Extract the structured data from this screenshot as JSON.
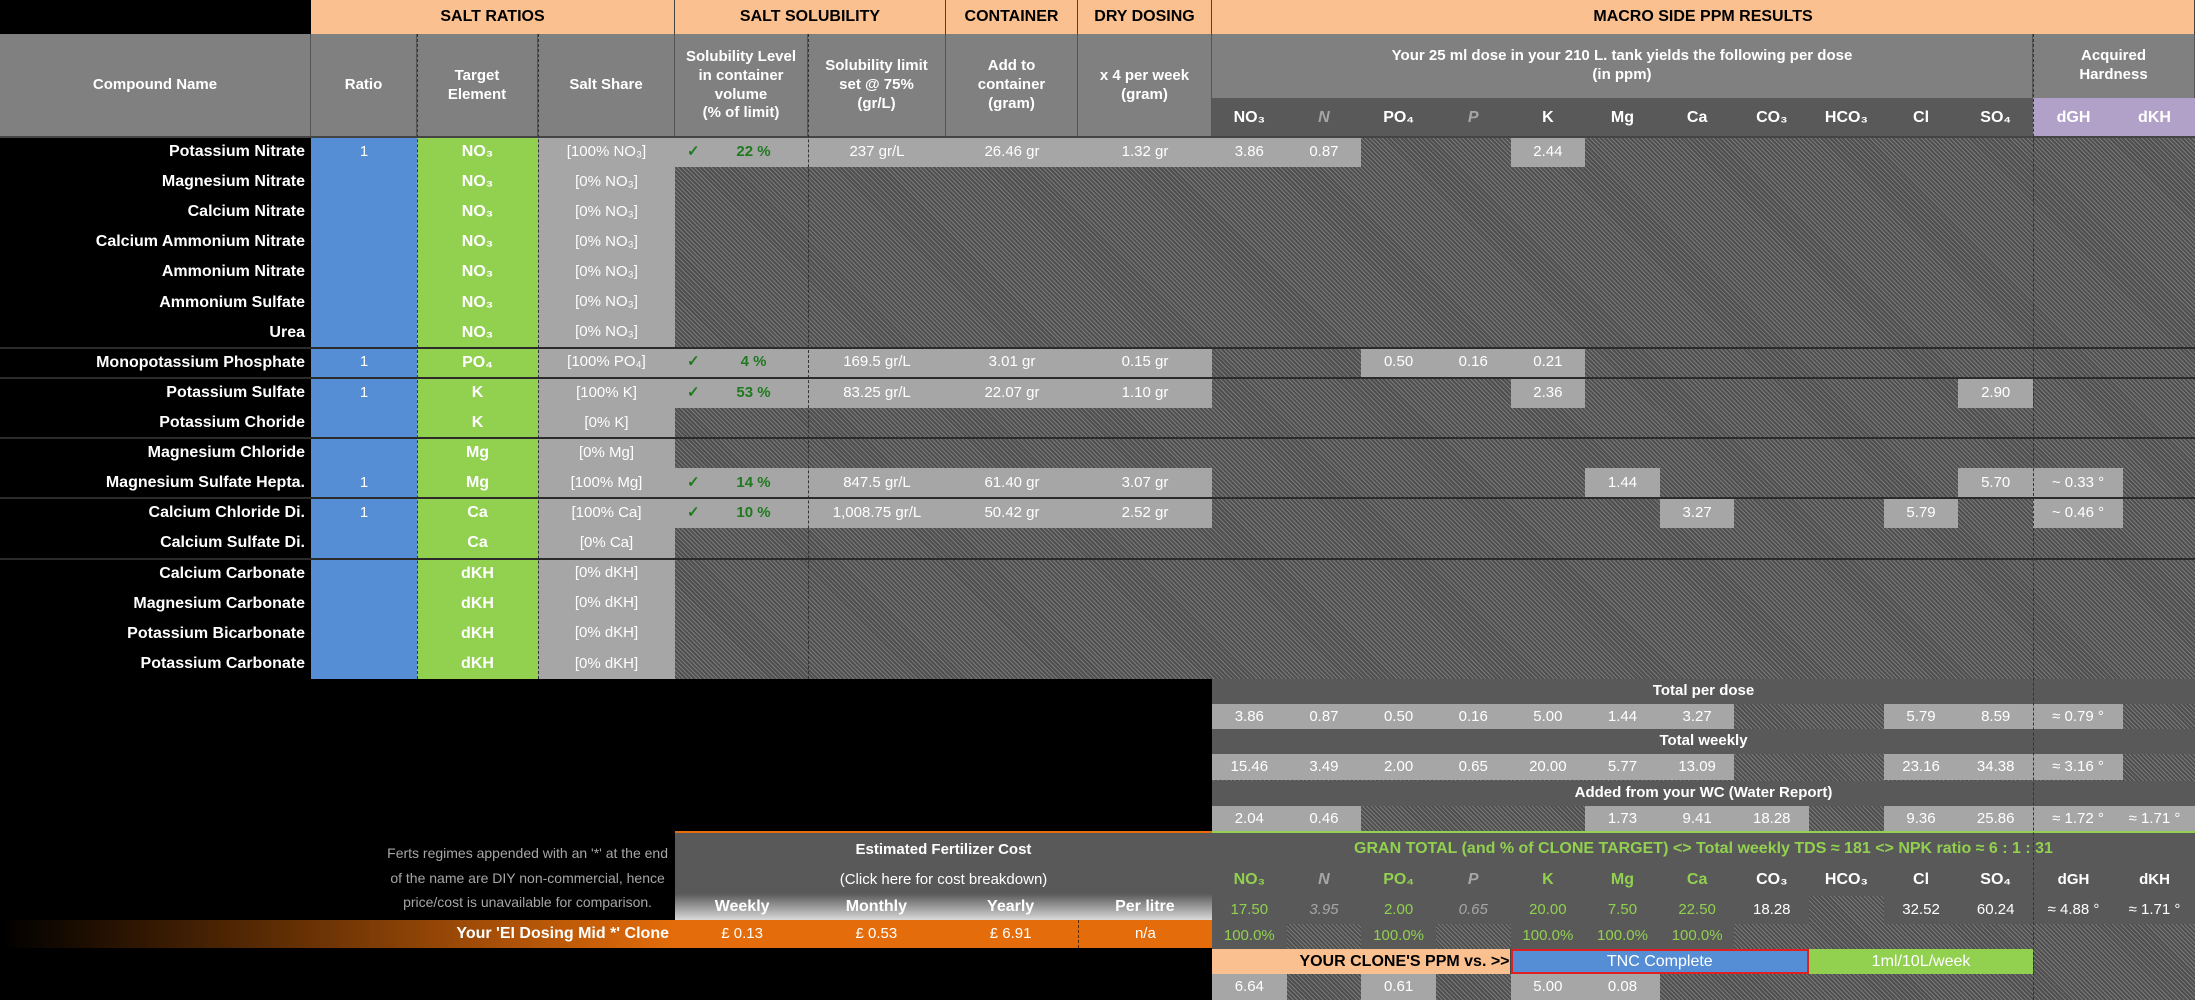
{
  "header": {
    "salt_ratios": "SALT  RATIOS",
    "salt_solubility": "SALT SOLUBILITY",
    "container": "CONTAINER",
    "dry_dosing": "DRY  DOSING",
    "macro": "MACRO SIDE PPM RESULTS"
  },
  "columns": {
    "compound": "Compound Name",
    "ratio": "Ratio",
    "target": "Target\nElement",
    "share": "Salt Share",
    "sol_level": "Solubility Level\nin container\nvolume\n(% of limit)",
    "sol_limit": "Solubility limit\nset @ 75%\n(gr/L)",
    "add": "Add to\ncontainer\n(gram)",
    "dry": "x 4 per week\n(gram)"
  },
  "macro_caption": "Your 25 ml dose in your 210 L. tank yields the following per dose\n(in ppm)",
  "hardness_caption": "Acquired\nHardness",
  "elements": [
    "NO₃",
    "N",
    "PO₄",
    "P",
    "K",
    "Mg",
    "Ca",
    "CO₃",
    "HCO₃",
    "Cl",
    "SO₄"
  ],
  "hardness_cols": [
    "dGH",
    "dKH"
  ],
  "rows": [
    {
      "name": "Potassium Nitrate",
      "ratio": "1",
      "target": "NO₃",
      "share": "[100% NO₃]",
      "sol_level": "22 %",
      "sol_limit": "237 gr/L",
      "add": "26.46 gr",
      "dry": "1.32 gr",
      "ppm": [
        "3.86",
        "0.87",
        null,
        null,
        "2.44",
        null,
        null,
        null,
        null,
        null,
        null
      ],
      "dgh": null
    },
    {
      "name": "Magnesium Nitrate",
      "ratio": "",
      "target": "NO₃",
      "share": "[0% NO₃]"
    },
    {
      "name": "Calcium Nitrate",
      "ratio": "",
      "target": "NO₃",
      "share": "[0% NO₃]"
    },
    {
      "name": "Calcium Ammonium Nitrate",
      "ratio": "",
      "target": "NO₃",
      "share": "[0% NO₃]"
    },
    {
      "name": "Ammonium Nitrate",
      "ratio": "",
      "target": "NO₃",
      "share": "[0% NO₃]"
    },
    {
      "name": "Ammonium Sulfate",
      "ratio": "",
      "target": "NO₃",
      "share": "[0% NO₃]"
    },
    {
      "name": "Urea",
      "ratio": "",
      "target": "NO₃",
      "share": "[0% NO₃]"
    },
    {
      "name": "Monopotassium Phosphate",
      "ratio": "1",
      "target": "PO₄",
      "share": "[100% PO₄]",
      "sol_level": "4 %",
      "sol_limit": "169.5 gr/L",
      "add": "3.01 gr",
      "dry": "0.15 gr",
      "ppm": [
        null,
        null,
        "0.50",
        "0.16",
        "0.21",
        null,
        null,
        null,
        null,
        null,
        null
      ],
      "dgh": null
    },
    {
      "name": "Potassium Sulfate",
      "ratio": "1",
      "target": "K",
      "share": "[100% K]",
      "sol_level": "53 %",
      "sol_limit": "83.25 gr/L",
      "add": "22.07 gr",
      "dry": "1.10 gr",
      "ppm": [
        null,
        null,
        null,
        null,
        "2.36",
        null,
        null,
        null,
        null,
        null,
        "2.90"
      ],
      "dgh": null
    },
    {
      "name": "Potassium Choride",
      "ratio": "",
      "target": "K",
      "share": "[0% K]"
    },
    {
      "name": "Magnesium Chloride",
      "ratio": "",
      "target": "Mg",
      "share": "[0% Mg]"
    },
    {
      "name": "Magnesium Sulfate Hepta.",
      "ratio": "1",
      "target": "Mg",
      "share": "[100% Mg]",
      "sol_level": "14 %",
      "sol_limit": "847.5 gr/L",
      "add": "61.40 gr",
      "dry": "3.07 gr",
      "ppm": [
        null,
        null,
        null,
        null,
        null,
        "1.44",
        null,
        null,
        null,
        null,
        "5.70"
      ],
      "dgh": "~ 0.33 °"
    },
    {
      "name": "Calcium Chloride Di.",
      "ratio": "1",
      "target": "Ca",
      "share": "[100% Ca]",
      "sol_level": "10 %",
      "sol_limit": "1,008.75 gr/L",
      "add": "50.42 gr",
      "dry": "2.52 gr",
      "ppm": [
        null,
        null,
        null,
        null,
        null,
        null,
        "3.27",
        null,
        null,
        "5.79",
        null
      ],
      "dgh": "~ 0.46 °"
    },
    {
      "name": "Calcium Sulfate Di.",
      "ratio": "",
      "target": "Ca",
      "share": "[0% Ca]"
    },
    {
      "name": "Calcium Carbonate",
      "ratio": "",
      "target": "dKH",
      "share": "[0% dKH]"
    },
    {
      "name": "Magnesium Carbonate",
      "ratio": "",
      "target": "dKH",
      "share": "[0% dKH]"
    },
    {
      "name": "Potassium Bicarbonate",
      "ratio": "",
      "target": "dKH",
      "share": "[0% dKH]"
    },
    {
      "name": "Potassium Carbonate",
      "ratio": "",
      "target": "dKH",
      "share": "[0% dKH]"
    }
  ],
  "totals": [
    {
      "label": "Total per dose",
      "values": [
        "3.86",
        "0.87",
        "0.50",
        "0.16",
        "5.00",
        "1.44",
        "3.27",
        null,
        null,
        "5.79",
        "8.59"
      ],
      "dgh": "≈ 0.79 °",
      "dkh": null
    },
    {
      "label": "Total weekly",
      "values": [
        "15.46",
        "3.49",
        "2.00",
        "0.65",
        "20.00",
        "5.77",
        "13.09",
        null,
        null,
        "23.16",
        "34.38"
      ],
      "dgh": "≈ 3.16 °",
      "dkh": null
    },
    {
      "label": "Added from your WC (Water Report)",
      "values": [
        "2.04",
        "0.46",
        null,
        null,
        null,
        "1.73",
        "9.41",
        "18.28",
        null,
        "9.36",
        "25.86"
      ],
      "dgh": "≈ 1.72 °",
      "dkh": "≈ 1.71 °"
    }
  ],
  "grand_total": {
    "title": "GRAN TOTAL (and % of CLONE TARGET) <> Total weekly TDS ≈ 181 <>  NPK ratio ≈ 6 : 1 : 31",
    "values": [
      "17.50",
      "3.95",
      "2.00",
      "0.65",
      "20.00",
      "7.50",
      "22.50",
      "18.28",
      null,
      "32.52",
      "60.24"
    ],
    "dgh": "≈ 4.88 °",
    "dkh": "≈ 1.71 °",
    "percent": [
      "100.0%",
      null,
      "100.0%",
      null,
      "100.0%",
      "100.0%",
      "100.0%",
      null,
      null,
      null,
      null
    ]
  },
  "clone_compare": {
    "label": "YOUR CLONE'S PPM vs. >>",
    "product": "TNC Complete",
    "dosage": "1ml/10L/week",
    "values": [
      "6.64",
      null,
      "0.61",
      null,
      "5.00",
      "0.08",
      null,
      null,
      null,
      null,
      null
    ]
  },
  "note": "Ferts regimes appended with an '*' at the end\nof the name are DIY non-commercial, hence\nprice/cost is unavailable for comparison.",
  "cost": {
    "title": "Estimated Fertilizer Cost",
    "link": "(Click here for cost breakdown)",
    "headers": [
      "Weekly",
      "Monthly",
      "Yearly",
      "Per litre"
    ],
    "regime": "Your 'EI Dosing Mid *' Clone",
    "values": [
      "£ 0.13",
      "£ 0.53",
      "£ 6.91",
      "n/a"
    ]
  },
  "colors": {
    "header": "#fac090",
    "ratio": "#558ed5",
    "target": "#92d050",
    "hardness": "#b1a0c7",
    "cost": "#e46c0a",
    "ok": "#1f7a1f"
  },
  "icons": {
    "solubility_ok": "check-icon"
  }
}
